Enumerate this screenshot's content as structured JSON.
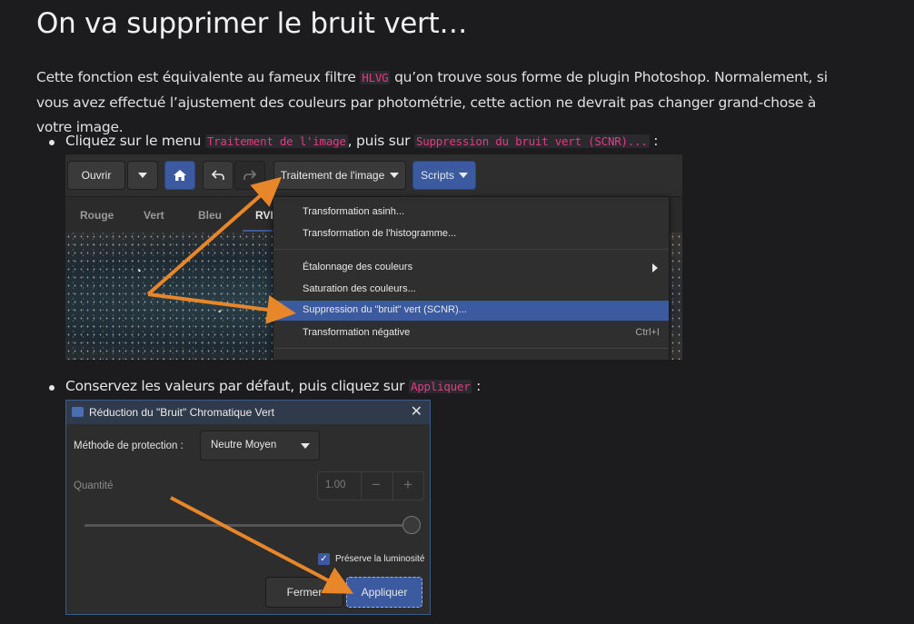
{
  "heading": "On va supprimer le bruit vert…",
  "intro": {
    "part1": "Cette fonction est équivalente au fameux filtre ",
    "code": "HLVG",
    "part2": " qu’on trouve sous forme de plugin Photoshop. Normalement, si vous avez effectué l’ajustement des couleurs par photométrie, cette action ne devrait pas changer grand-chose à votre image."
  },
  "step1": {
    "text1": "Cliquez sur le menu ",
    "code1": "Traitement de l'image",
    "text2": ", puis sur ",
    "code2": "Suppression du bruit vert (SCNR)...",
    "text3": " :"
  },
  "step2": {
    "text1": "Conservez les valeurs par défaut, puis cliquez sur ",
    "code1": "Appliquer",
    "text2": " :"
  },
  "toolbar": {
    "open_label": "Ouvrir",
    "image_menu_label": "Traitement de l'image",
    "scripts_label": "Scripts",
    "icons": [
      "chevron-down-icon",
      "home-icon",
      "undo-icon",
      "redo-icon"
    ]
  },
  "tabs": [
    "Rouge",
    "Vert",
    "Bleu",
    "RVB"
  ],
  "menu": {
    "items": [
      {
        "label": "Transformation asinh...",
        "accel": ""
      },
      {
        "label": "Transformation de l'histogramme...",
        "accel": ""
      },
      {
        "label": "Étalonnage des couleurs",
        "accel": ""
      },
      {
        "label": "Saturation des couleurs...",
        "accel": ""
      },
      {
        "label": "Suppression du \"bruit\" vert (SCNR)...",
        "accel": ""
      },
      {
        "label": "Transformation négative",
        "accel": "Ctrl+I"
      }
    ],
    "highlight_color": "#3b5aa0"
  },
  "dialog": {
    "title": "Réduction du \"Bruit\" Chromatique Vert",
    "method_label": "Méthode de protection :",
    "method_value": "Neutre Moyen",
    "amount_label": "Quantité",
    "amount_value": "1.00",
    "amount_slider_level": 1.0,
    "preserve_label": "Préserve la luminosité",
    "preserve_checked": true,
    "close_label": "Fermer",
    "apply_label": "Appliquer"
  },
  "colors": {
    "accent": "#3b5aa0",
    "code": "#e23a83",
    "arrow": "#e8862a"
  }
}
